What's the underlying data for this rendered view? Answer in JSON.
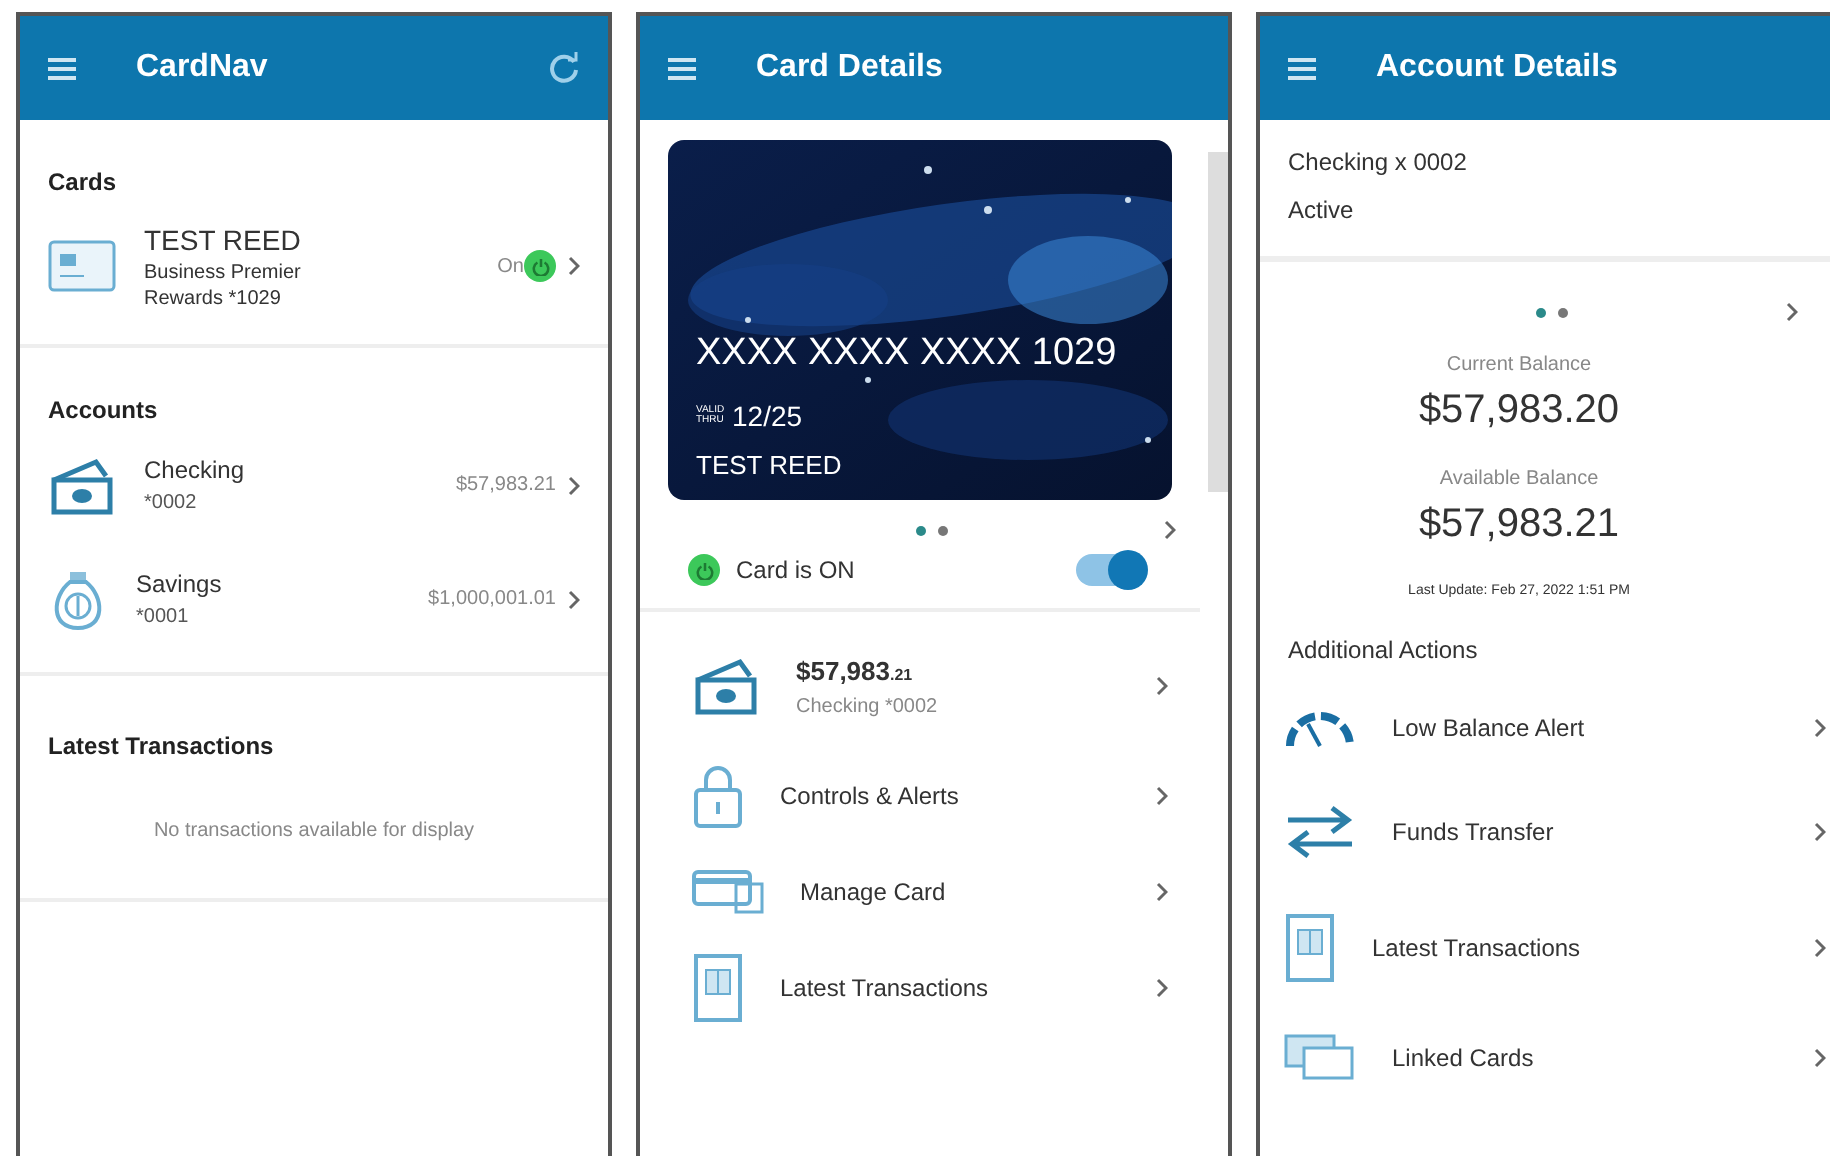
{
  "cardnav": {
    "title": "CardNav",
    "cards_heading": "Cards",
    "card": {
      "name": "TEST REED",
      "description": "Business Premier Rewards *1029",
      "status": "On",
      "on": true
    },
    "accounts_heading": "Accounts",
    "accounts": [
      {
        "kind": "checking",
        "name": "Checking",
        "number": "*0002",
        "balance": "$57,983.21"
      },
      {
        "kind": "savings",
        "name": "Savings",
        "number": "*0001",
        "balance": "$1,000,001.01"
      }
    ],
    "transactions_heading": "Latest Transactions",
    "transactions_empty": "No transactions available for display"
  },
  "card_details": {
    "title": "Card Details",
    "card": {
      "number": "XXXX XXXX XXXX 1029",
      "valid_label": "VALID THRU",
      "expiry": "12/25",
      "holder": "TEST REED"
    },
    "carousel": [
      {
        "selected": true
      },
      {
        "selected": false
      }
    ],
    "card_status": {
      "label": "Card is ON",
      "on": true
    },
    "items": [
      {
        "kind": "account",
        "amount": "$57,983",
        "cents": ".21",
        "subtitle": "Checking *0002"
      },
      {
        "kind": "lock",
        "label": "Controls & Alerts"
      },
      {
        "kind": "card",
        "label": "Manage Card"
      },
      {
        "kind": "transactions",
        "label": "Latest Transactions"
      }
    ]
  },
  "account_details": {
    "title": "Account Details",
    "account": "Checking x 0002",
    "status": "Active",
    "carousel": [
      {
        "selected": true
      },
      {
        "selected": false
      }
    ],
    "current_label": "Current Balance",
    "current": "$57,983.20",
    "available_label": "Available Balance",
    "available": "$57,983.21",
    "last_update": "Last Update: Feb 27, 2022 1:51 PM",
    "actions_heading": "Additional Actions",
    "actions": [
      {
        "kind": "gauge",
        "label": "Low Balance Alert"
      },
      {
        "kind": "transfer",
        "label": "Funds Transfer"
      },
      {
        "kind": "transactions",
        "label": "Latest Transactions"
      },
      {
        "kind": "cards",
        "label": "Linked Cards"
      }
    ]
  }
}
